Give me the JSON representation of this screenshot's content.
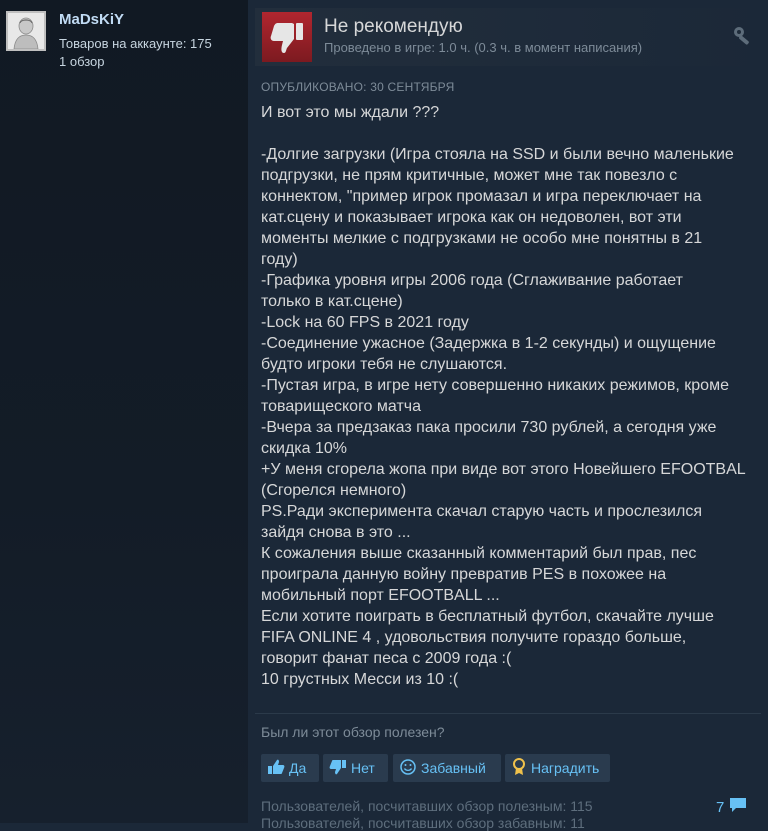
{
  "author": {
    "name": "MaDsKiY",
    "products": "Товаров на аккаунте: 175",
    "reviews": "1 обзор"
  },
  "review": {
    "verdict": "Не рекомендую",
    "hours": "Проведено в игре: 1.0 ч. (0.3 ч. в момент написания)",
    "posted": "Опубликовано: 30 сентября",
    "body_lines": [
      "И вот это мы ждали ???",
      "",
      "-Долгие загрузки (Игра стояла на SSD и были вечно маленькие",
      "подгрузки, не прям критичные, может мне так повезло с",
      "коннектом, \"пример игрок промазал и игра переключает на",
      "кат.сцену и показывает игрока как он недоволен, вот эти",
      "моменты мелкие с подгрузками не особо мне понятны в 21",
      "году)",
      "-Графика уровня игры 2006 года (Сглаживание работает",
      "только в кат.сцене)",
      "-Lock на 60 FPS в 2021 году",
      "-Соединение ужасное (Задержка в 1-2 секунды) и ощущение",
      "будто игроки тебя не слушаются.",
      "-Пустая игра, в игре нету совершенно никаких режимов, кроме",
      "товарищеского матча",
      "-Вчера за предзаказ пака просили 730 рублей, а сегодня уже",
      "скидка 10%",
      "+У меня сгорела жопа при виде вот этого Новейшего EFOOTBAL",
      "(Сгорелся немного)",
      "PS.Ради эксперимента скачал старую часть и прослезился",
      "зайдя снова в это ...",
      "К сожаления выше сказанный комментарий был прав, пес",
      "проиграла данную войну превратив PES в похожее на",
      "мобильный порт EFOOTBALL ...",
      "Если хотите поиграть в бесплатный футбол, скачайте лучше",
      "FIFA ONLINE 4 , удовольствия получите гораздо больше,",
      "говорит фанат песа с 2009 года :(",
      "10 грустных Месси из 10 :("
    ]
  },
  "feedback": {
    "question": "Был ли этот обзор полезен?",
    "yes_label": "Да",
    "no_label": "Нет",
    "funny_label": "Забавный",
    "award_label": "Наградить",
    "helpful_count_text": "Пользователей, посчитавших обзор полезным: 115",
    "funny_count_text": "Пользователей, посчитавших обзор забавным: 11",
    "comment_count": "7"
  },
  "colors": {
    "background": "#1b2838",
    "accent_link": "#67c1f5",
    "thumb_down": "#b1262f"
  },
  "icons": {
    "thumb_down": "thumbs-down-icon",
    "settings": "wrench-icon",
    "comment": "comment-icon",
    "award": "award-icon"
  }
}
